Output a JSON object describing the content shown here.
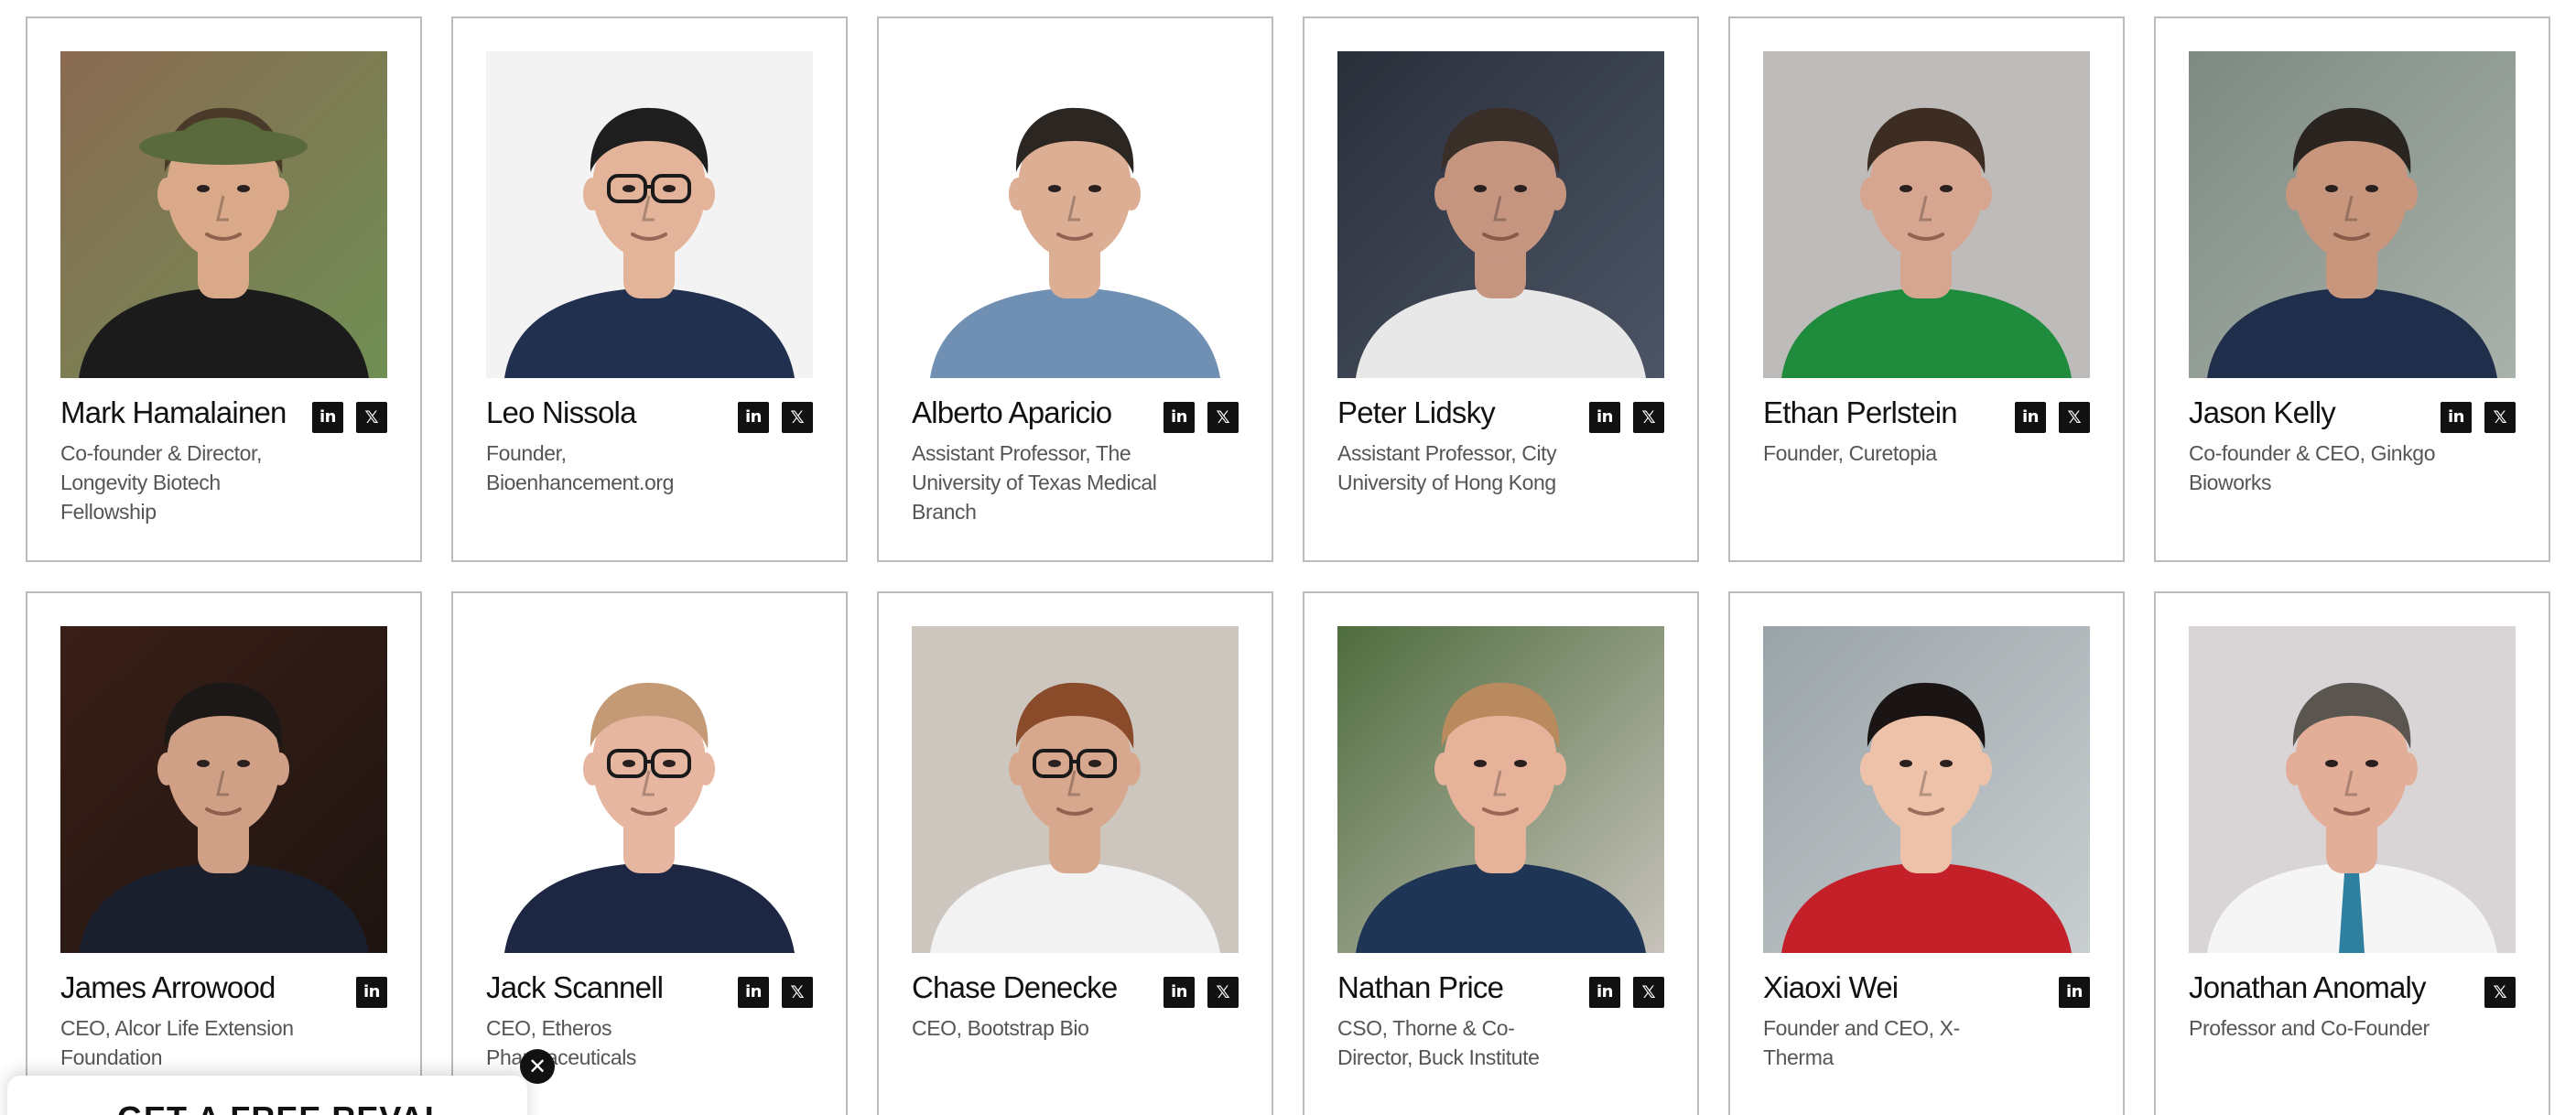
{
  "people": [
    {
      "name": "Mark Hamalainen",
      "role": "Co-founder & Director, Longevity Biotech Fellowship",
      "linkedin": true,
      "x": true,
      "photo": {
        "bg": "#8a6a52",
        "bg2": "#6f8f54",
        "skin": "#d9a98a",
        "hair": "#4a3a2a",
        "shirt": "#1b1b1b",
        "hat": "#5b6a3c"
      }
    },
    {
      "name": "Leo Nissola",
      "role": "Founder, Bioenhancement.org",
      "linkedin": true,
      "x": true,
      "photo": {
        "bg": "#f3f3f3",
        "bg2": "#f3f3f3",
        "skin": "#e3b49a",
        "hair": "#1e1e1e",
        "shirt": "#22304f",
        "glasses": true
      }
    },
    {
      "name": "Alberto Aparicio",
      "role": "Assistant Professor, The University of Texas Medical Branch",
      "linkedin": true,
      "x": true,
      "photo": {
        "bg": "#ffffff",
        "bg2": "#ffffff",
        "skin": "#dcae94",
        "hair": "#2c2622",
        "shirt": "#6f8fb3"
      }
    },
    {
      "name": "Peter Lidsky",
      "role": "Assistant Professor, City University of Hong Kong",
      "linkedin": true,
      "x": true,
      "photo": {
        "bg": "#2a2f3a",
        "bg2": "#4c5566",
        "skin": "#c59580",
        "hair": "#3a2e28",
        "shirt": "#e8e8e8"
      }
    },
    {
      "name": "Ethan Perlstein",
      "role": "Founder, Curetopia",
      "linkedin": true,
      "x": true,
      "photo": {
        "bg": "#bdbcbb",
        "bg2": "#bdbcbb",
        "skin": "#d7a690",
        "hair": "#3d2c22",
        "shirt": "#1f8b3c"
      }
    },
    {
      "name": "Jason Kelly",
      "role": "Co-founder & CEO, Ginkgo Bioworks",
      "linkedin": true,
      "x": true,
      "photo": {
        "bg": "#7d8a83",
        "bg2": "#a9b2aa",
        "skin": "#c8967c",
        "hair": "#2a2420",
        "shirt": "#1f2e4a"
      }
    },
    {
      "name": "James Arrowood",
      "role": "CEO, Alcor Life Extension Foundation",
      "linkedin": true,
      "x": false,
      "photo": {
        "bg": "#3a1f18",
        "bg2": "#1e1410",
        "skin": "#d0a086",
        "hair": "#1c1818",
        "shirt": "#1a1f2e"
      }
    },
    {
      "name": "Jack Scannell",
      "role": "CEO, Etheros Pharmaceuticals",
      "linkedin": true,
      "x": true,
      "photo": {
        "bg": "#ffffff",
        "bg2": "#ffffff",
        "skin": "#e7b6a0",
        "hair": "#c49a76",
        "shirt": "#1d2744",
        "glasses": true
      }
    },
    {
      "name": "Chase Denecke",
      "role": "CEO, Bootstrap Bio",
      "linkedin": true,
      "x": true,
      "photo": {
        "bg": "#cdc6bf",
        "bg2": "#cdc6bf",
        "skin": "#d8a88e",
        "hair": "#8a4b2a",
        "shirt": "#f2f2f2",
        "glasses": true
      }
    },
    {
      "name": "Nathan Price",
      "role": "CSO, Thorne & Co-Director, Buck Institute",
      "linkedin": true,
      "x": true,
      "photo": {
        "bg": "#4f6d3e",
        "bg2": "#c7c2bb",
        "skin": "#e6b29a",
        "hair": "#b88a5e",
        "shirt": "#1e3556"
      }
    },
    {
      "name": "Xiaoxi Wei",
      "role": "Founder and CEO, X-Therma",
      "linkedin": true,
      "x": false,
      "photo": {
        "bg": "#9aa4a8",
        "bg2": "#c9ced0",
        "skin": "#eec2a8",
        "hair": "#1a1414",
        "shirt": "#c4202a"
      }
    },
    {
      "name": "Jonathan Anomaly",
      "role": "Professor and Co-Founder",
      "linkedin": false,
      "x": true,
      "photo": {
        "bg": "#d9d4d6",
        "bg2": "#d9d4d6",
        "skin": "#e2ae98",
        "hair": "#5b5550",
        "shirt": "#f5f5f5",
        "tie": "#2e7fa0"
      }
    }
  ],
  "icons": {
    "linkedin": "in",
    "x": "𝕏"
  },
  "popup": {
    "title": "GET A FREE REVAL",
    "close": "✕"
  }
}
